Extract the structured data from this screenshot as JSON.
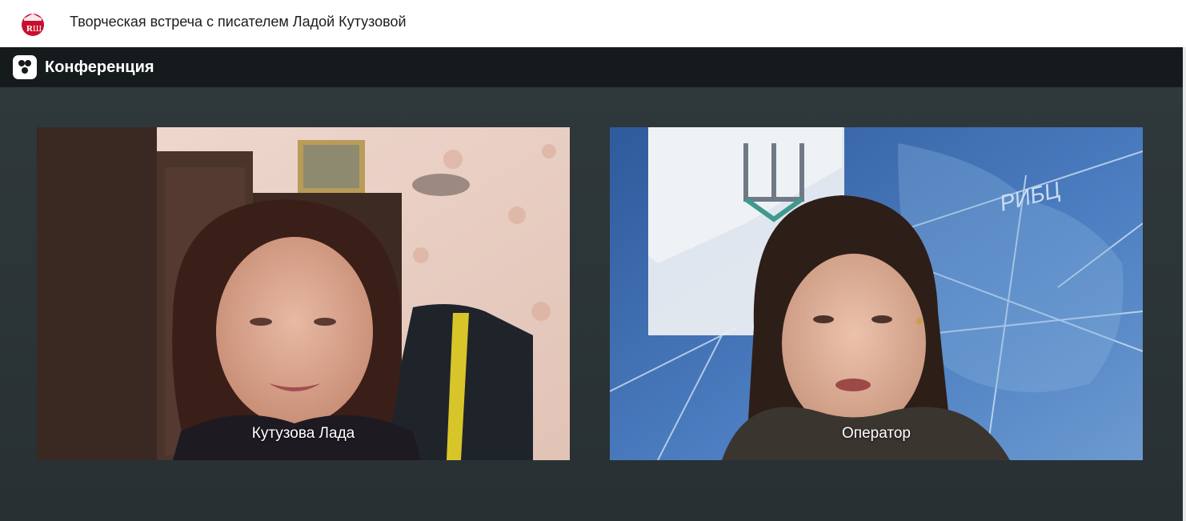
{
  "header": {
    "title": "Творческая встреча с писателем Ладой Кутузовой",
    "logo_icon": "site-logo-icon"
  },
  "conference_bar": {
    "title": "Конференция",
    "icon": "conference-icon"
  },
  "participants": [
    {
      "name": "Кутузова Лада"
    },
    {
      "name": "Оператор"
    }
  ],
  "colors": {
    "header_bg": "#ffffff",
    "conference_bar_bg": "#151a1c",
    "stage_bg": "#2b3336",
    "logo_red": "#c8102e"
  }
}
